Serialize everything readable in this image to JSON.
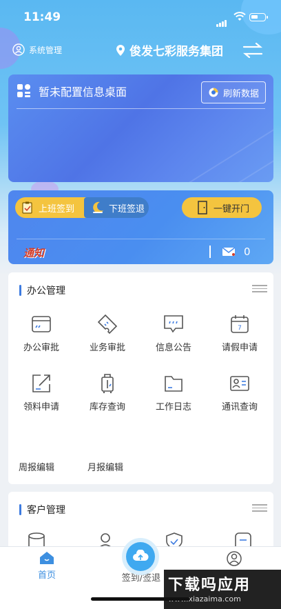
{
  "status": {
    "time": "11:49"
  },
  "topbar": {
    "sys_label": "系统管理",
    "org_name": "俊发七彩服务集团"
  },
  "info_card": {
    "title": "暂未配置信息桌面",
    "refresh_label": "刷新数据"
  },
  "attendance": {
    "checkin_label": "上班签到",
    "checkout_label": "下班签退",
    "open_door_label": "一键开门",
    "notice_label": "通知",
    "message_count": "0"
  },
  "office": {
    "title": "办公管理",
    "items": [
      {
        "label": "办公审批",
        "icon": "browser-window-icon"
      },
      {
        "label": "业务审批",
        "icon": "ticket-icon"
      },
      {
        "label": "信息公告",
        "icon": "chat-bubble-icon"
      },
      {
        "label": "请假申请",
        "icon": "calendar-icon"
      },
      {
        "label": "领料申请",
        "icon": "export-box-icon"
      },
      {
        "label": "库存查询",
        "icon": "luggage-icon"
      },
      {
        "label": "工作日志",
        "icon": "folder-icon"
      },
      {
        "label": "通讯查询",
        "icon": "contact-card-icon"
      },
      {
        "label": "周报编辑",
        "icon": ""
      },
      {
        "label": "月报编辑",
        "icon": ""
      }
    ]
  },
  "customer": {
    "title": "客户管理"
  },
  "tabbar": {
    "home": "首页",
    "checkin": "签到/签退",
    "me": ""
  },
  "watermark": {
    "big": "下载吗应用",
    "small": "www.xiazaima.com"
  },
  "colors": {
    "accent": "#3d7be0",
    "yellow": "#f4c43f",
    "notice_red": "#d23d2a"
  }
}
